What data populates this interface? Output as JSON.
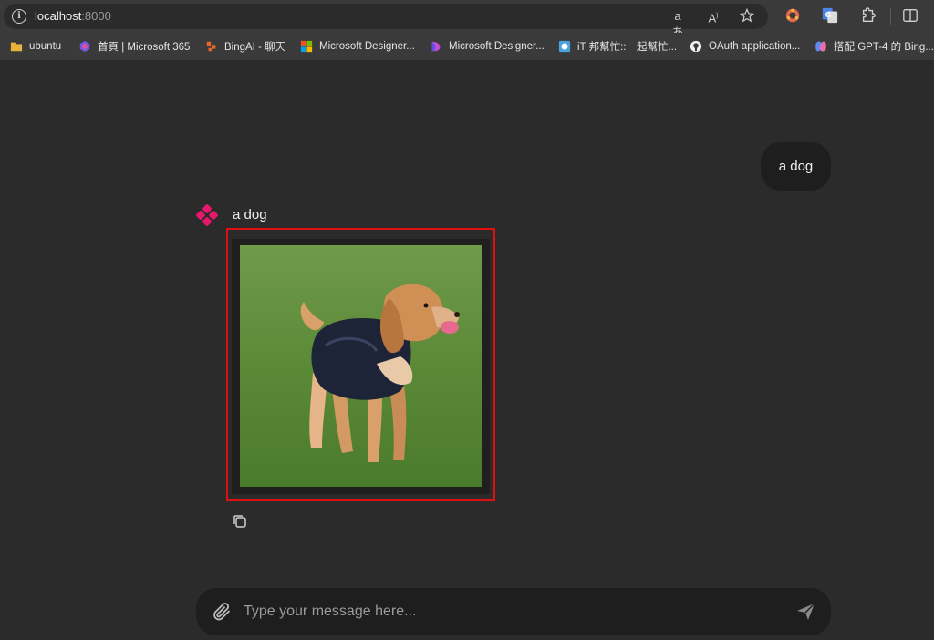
{
  "browser": {
    "url_host": "localhost",
    "url_port": ":8000",
    "icons": [
      "info-icon",
      "read-aloud-icon",
      "text-size-icon",
      "favorite-star-icon",
      "extension-colorful-icon",
      "google-translate-icon",
      "extensions-puzzle-icon",
      "split-screen-icon"
    ]
  },
  "bookmarks": [
    {
      "label": "ubuntu",
      "icon": "folder-icon",
      "color": "#e8b43a"
    },
    {
      "label": "首頁 | Microsoft 365",
      "icon": "microsoft365-icon",
      "color": "#6a5ae0"
    },
    {
      "label": "BingAI - 聊天",
      "icon": "bing-icon",
      "color": "#e6672b"
    },
    {
      "label": "Microsoft Designer...",
      "icon": "microsoft-logo-icon",
      "color": "#f25022"
    },
    {
      "label": "Microsoft Designer...",
      "icon": "designer-icon",
      "color": "#c74bd8"
    },
    {
      "label": "iT 邦幫忙::一起幫忙...",
      "icon": "ithelp-icon",
      "color": "#4aa3df"
    },
    {
      "label": "OAuth application...",
      "icon": "github-icon",
      "color": "#f0f0f0"
    },
    {
      "label": "搭配 GPT-4 的 Bing...",
      "icon": "copilot-icon",
      "color": "#5b8cf0"
    }
  ],
  "chat": {
    "user_message": "a dog",
    "bot_message": "a dog",
    "input_placeholder": "Type your message here...",
    "accent": "#e6186b",
    "highlight_border": "#e01010"
  }
}
